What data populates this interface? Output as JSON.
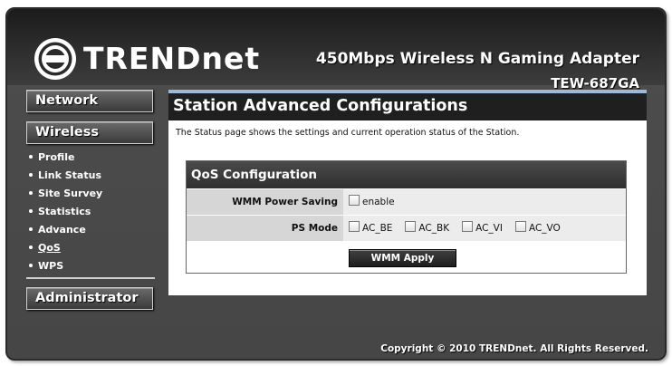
{
  "header": {
    "brand": "TRENDnet",
    "product_name": "450Mbps Wireless N Gaming Adapter",
    "model": "TEW-687GA"
  },
  "nav": {
    "network": "Network",
    "wireless": "Wireless",
    "wireless_items": [
      {
        "label": "Profile"
      },
      {
        "label": "Link Status"
      },
      {
        "label": "Site Survey"
      },
      {
        "label": "Statistics"
      },
      {
        "label": "Advance"
      },
      {
        "label": "QoS"
      },
      {
        "label": "WPS"
      }
    ],
    "administrator": "Administrator"
  },
  "content": {
    "title": "Station Advanced Configurations",
    "description": "The Status page shows the settings and current operation status of the Station.",
    "qos": {
      "title": "QoS Configuration",
      "wmm_label": "WMM Power Saving",
      "wmm_enable": "enable",
      "ps_label": "PS Mode",
      "ps_options": [
        {
          "label": "AC_BE",
          "checked": false
        },
        {
          "label": "AC_BK",
          "checked": false
        },
        {
          "label": "AC_VI",
          "checked": false
        },
        {
          "label": "AC_VO",
          "checked": false
        }
      ],
      "apply_label": "WMM Apply"
    }
  },
  "footer": {
    "copyright": "Copyright © 2010 TRENDnet. All Rights Reserved."
  }
}
